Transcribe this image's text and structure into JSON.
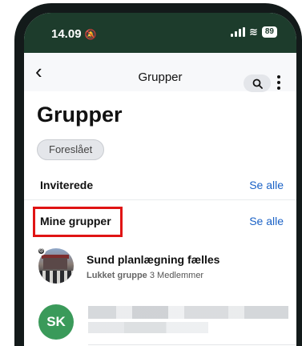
{
  "status_bar": {
    "time": "14.09",
    "battery": "89"
  },
  "app_bar": {
    "title": "Grupper"
  },
  "page": {
    "title": "Grupper",
    "chip_label": "Foreslået"
  },
  "sections": {
    "invited": {
      "label": "Inviterede",
      "see_all": "Se alle"
    },
    "my_groups": {
      "label": "Mine grupper",
      "see_all": "Se alle"
    }
  },
  "groups": [
    {
      "name": "Sund planlægning fælles",
      "type": "Lukket gruppe",
      "members": "3 Medlemmer"
    },
    {
      "initials": "SK"
    }
  ],
  "colors": {
    "status_bar_bg": "#1d3c2c",
    "link": "#1b62c6",
    "highlight": "#e01414",
    "avatar_sk": "#3a9a5a"
  }
}
